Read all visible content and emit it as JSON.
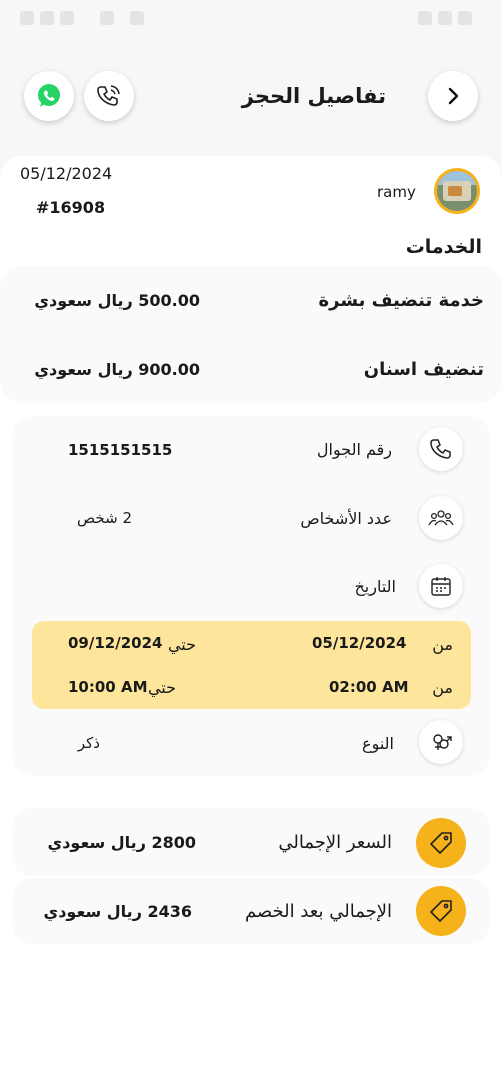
{
  "header": {
    "title": "تفاصيل الحجز"
  },
  "booking": {
    "customer_name": "ramy",
    "date": "05/12/2024",
    "booking_number": "#16908"
  },
  "services": {
    "heading": "الخدمات",
    "items": [
      {
        "name": "خدمة تنضيف بشرة",
        "price": "500.00 ريال سعودي"
      },
      {
        "name": "تنضيف اسنان",
        "price": "900.00 ريال سعودي"
      }
    ]
  },
  "details": {
    "phone_label": "رقم الجوال",
    "phone_value": "1515151515",
    "persons_label": "عدد الأشخاص",
    "persons_value": "2 شخص",
    "date_label": "التاريخ",
    "from_label_1": "من",
    "from_date": "05/12/2024",
    "to_label_1": "حتي",
    "to_date": "09/12/2024",
    "from_label_2": "من",
    "from_time": "02:00 AM",
    "to_label_2": "حتي",
    "to_time": "10:00 AM",
    "gender_label": "النوع",
    "gender_value": "ذكر"
  },
  "totals": {
    "total_label": "السعر الإجمالي",
    "total_value": "2800 ريال سعودي",
    "discounted_label": "الإجمالي بعد الخصم",
    "discounted_value": "2436 ريال سعودي"
  },
  "colors": {
    "accent": "#f6b21a",
    "date_band": "#fde69b",
    "whatsapp": "#25d366"
  }
}
